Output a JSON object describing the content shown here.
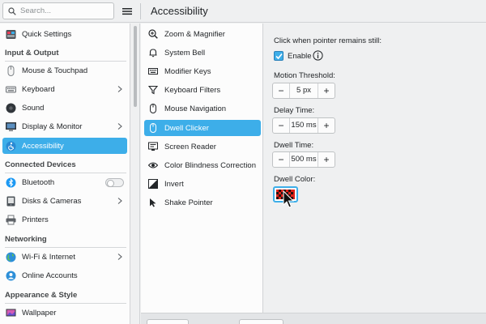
{
  "search": {
    "placeholder": "Search..."
  },
  "header": {
    "title": "Accessibility"
  },
  "sidebar": {
    "items": [
      {
        "label": "Quick Settings",
        "icon": "quick-settings-icon"
      },
      {
        "label": "Mouse & Touchpad",
        "icon": "mouse-icon"
      },
      {
        "label": "Keyboard",
        "icon": "keyboard-icon"
      },
      {
        "label": "Sound",
        "icon": "sound-icon"
      },
      {
        "label": "Display & Monitor",
        "icon": "monitor-icon"
      },
      {
        "label": "Accessibility",
        "icon": "accessibility-icon",
        "active": true
      },
      {
        "label": "Bluetooth",
        "icon": "bluetooth-icon",
        "toggle": "off"
      },
      {
        "label": "Disks & Cameras",
        "icon": "disk-icon"
      },
      {
        "label": "Printers",
        "icon": "printer-icon"
      },
      {
        "label": "Wi-Fi & Internet",
        "icon": "wifi-icon"
      },
      {
        "label": "Online Accounts",
        "icon": "online-accounts-icon"
      },
      {
        "label": "Wallpaper",
        "icon": "wallpaper-icon"
      }
    ],
    "headers": [
      "Input & Output",
      "Connected Devices",
      "Networking",
      "Appearance & Style"
    ]
  },
  "modules": {
    "items": [
      {
        "label": "Zoom & Magnifier",
        "icon": "zoom-icon"
      },
      {
        "label": "System Bell",
        "icon": "bell-icon"
      },
      {
        "label": "Modifier Keys",
        "icon": "keyboard-icon"
      },
      {
        "label": "Keyboard Filters",
        "icon": "filter-icon"
      },
      {
        "label": "Mouse Navigation",
        "icon": "mouse-icon"
      },
      {
        "label": "Dwell Clicker",
        "icon": "mouse-icon",
        "active": true
      },
      {
        "label": "Screen Reader",
        "icon": "screen-reader-icon"
      },
      {
        "label": "Color Blindness Correction",
        "icon": "eye-icon"
      },
      {
        "label": "Invert",
        "icon": "invert-icon"
      },
      {
        "label": "Shake Pointer",
        "icon": "pointer-icon"
      }
    ]
  },
  "dwell": {
    "intro": "Click when pointer remains still:",
    "enable_label": "Enable",
    "enabled": true,
    "motion_label": "Motion Threshold:",
    "motion_value": "5 px",
    "delay_label": "Delay Time:",
    "delay_value": "150 ms",
    "dwell_label": "Dwell Time:",
    "dwell_value": "500 ms",
    "color_label": "Dwell Color:",
    "minus": "−",
    "plus": "+"
  },
  "colors": {
    "accent": "#3daee9",
    "swatch_red": "#e0201a"
  }
}
